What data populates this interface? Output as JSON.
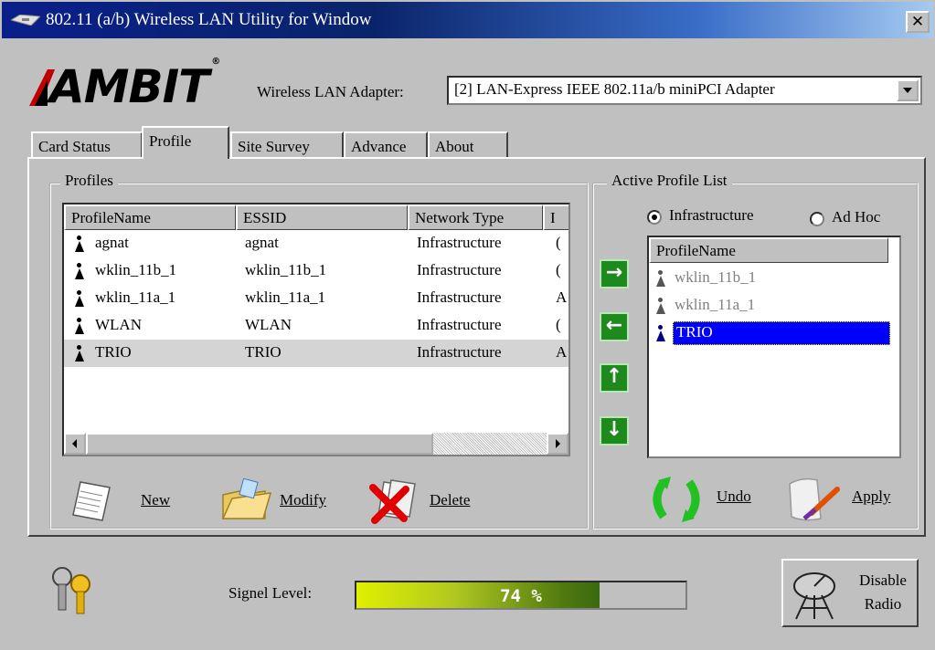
{
  "window": {
    "title": "802.11 (a/b) Wireless LAN Utility for Window",
    "close_glyph": "✕"
  },
  "header": {
    "logo": "AMBIT",
    "logo_mark": "®",
    "adapter_label": "Wireless LAN Adapter:",
    "adapter_selected": "[2] LAN-Express IEEE 802.11a/b miniPCI Adapter"
  },
  "tabs": [
    {
      "label": "Card Status",
      "active": false
    },
    {
      "label": "Profile",
      "active": true
    },
    {
      "label": "Site Survey",
      "active": false
    },
    {
      "label": "Advance",
      "active": false
    },
    {
      "label": "About",
      "active": false
    }
  ],
  "profiles": {
    "group_label": "Profiles",
    "columns": [
      "ProfileName",
      "ESSID",
      "Network Type",
      "I"
    ],
    "rows": [
      {
        "name": "agnat",
        "essid": "agnat",
        "type": "Infrastructure",
        "extra": "(",
        "selected": false
      },
      {
        "name": "wklin_11b_1",
        "essid": "wklin_11b_1",
        "type": "Infrastructure",
        "extra": "(",
        "selected": false
      },
      {
        "name": "wklin_11a_1",
        "essid": "wklin_11a_1",
        "type": "Infrastructure",
        "extra": "A",
        "selected": false
      },
      {
        "name": "WLAN",
        "essid": "WLAN",
        "type": "Infrastructure",
        "extra": "(",
        "selected": false
      },
      {
        "name": "TRIO",
        "essid": "TRIO",
        "type": "Infrastructure",
        "extra": "A",
        "selected": true
      }
    ],
    "actions": {
      "new": "New",
      "modify": "Modify",
      "delete": "Delete"
    }
  },
  "active_list": {
    "group_label": "Active Profile List",
    "mode_infrastructure": "Infrastructure",
    "mode_adhoc": "Ad Hoc",
    "selected_mode": "Infrastructure",
    "column": "ProfileName",
    "items": [
      {
        "name": "wklin_11b_1",
        "state": "disabled"
      },
      {
        "name": "wklin_11a_1",
        "state": "disabled"
      },
      {
        "name": "TRIO",
        "state": "selected"
      }
    ],
    "undo": "Undo",
    "apply": "Apply"
  },
  "move_buttons": [
    "→",
    "←",
    "↑",
    "↓"
  ],
  "status": {
    "signal_label": "Signel Level:",
    "signal_percent": 74,
    "signal_text": "74 %",
    "disable_line1": "Disable",
    "disable_line2": "Radio"
  },
  "colors": {
    "selection": "#0000ff",
    "row_highlight": "#d4d4d4",
    "arrow_green": "#1e8a1e"
  }
}
